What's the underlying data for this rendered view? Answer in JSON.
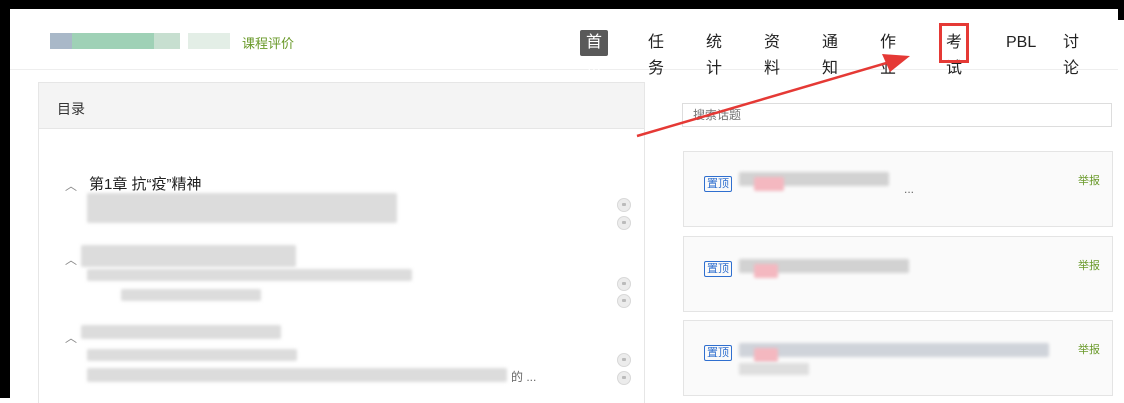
{
  "header": {
    "course_eval": "课程评价",
    "nav": [
      {
        "label": "首页",
        "active": true
      },
      {
        "label": "任务"
      },
      {
        "label": "统计"
      },
      {
        "label": "资料"
      },
      {
        "label": "通知"
      },
      {
        "label": "作业"
      },
      {
        "label": "考试",
        "highlighted": true
      },
      {
        "label": "PBL"
      },
      {
        "label": "讨论"
      }
    ]
  },
  "catalog": {
    "title": "目录",
    "chapter1_title": "第1章 抗“疫”精神",
    "tail_text": "的 ..."
  },
  "discussion": {
    "search_placeholder": "搜索话题",
    "posts": [
      {
        "badge": "置顶",
        "report": "举报",
        "ellipsis": "..."
      },
      {
        "badge": "置顶",
        "report": "举报"
      },
      {
        "badge": "置顶",
        "report": "举报"
      }
    ]
  },
  "colors": {
    "nav_active_bg": "#595959",
    "highlight_red": "#e53935",
    "eval_green": "#6a9a2a",
    "pin_blue": "#2f6fcf"
  }
}
